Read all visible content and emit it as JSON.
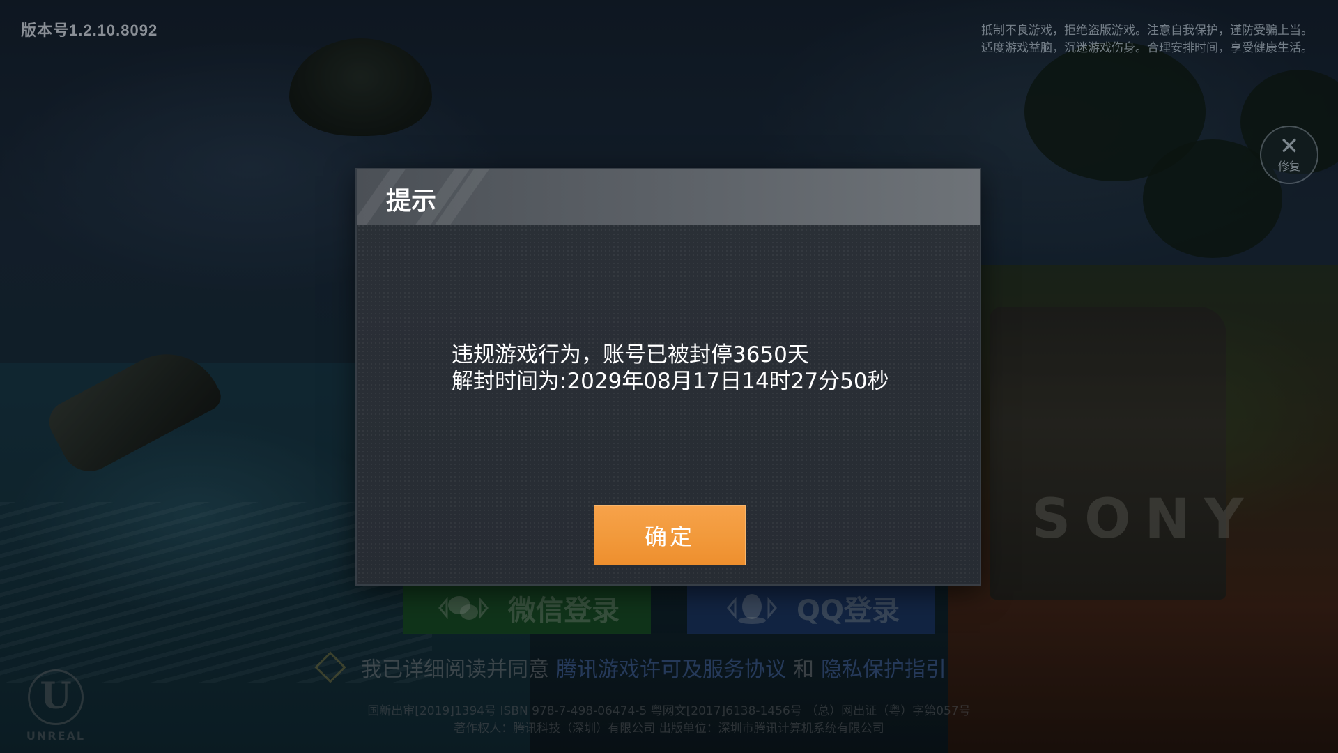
{
  "hud": {
    "version": "版本号1.2.10.8092",
    "notice_line1": "抵制不良游戏，拒绝盗版游戏。注意自我保护，谨防受骗上当。",
    "notice_line2": "适度游戏益脑，沉迷游戏伤身。合理安排时间，享受健康生活。",
    "repair_label": "修复"
  },
  "dialog": {
    "title": "提示",
    "message_line1": "违规游戏行为，账号已被封停3650天",
    "message_line2": "解封时间为:2029年08月17日14时27分50秒",
    "confirm_label": "确定"
  },
  "login": {
    "wechat_label": "微信登录",
    "qq_label": "QQ登录"
  },
  "agreement": {
    "prefix": "我已详细阅读并同意",
    "link1": "腾讯游戏许可及服务协议",
    "conjunction": "和",
    "link2": "隐私保护指引"
  },
  "footer": {
    "line1": "国新出审[2019]1394号  ISBN 978-7-498-06474-5  粤网文[2017]6138-1456号 （总）网出证（粤）字第057号",
    "line2": "著作权人：腾讯科技（深圳）有限公司  出版单位：深圳市腾讯计算机系统有限公司"
  },
  "engine_logo": {
    "word": "UNREAL"
  },
  "scene": {
    "truck_text": "SONY"
  },
  "colors": {
    "confirm_button": "#f29a3c",
    "wechat_button": "#1d5a2d",
    "qq_button": "#203f73",
    "dialog_background": "#2a2f36"
  }
}
